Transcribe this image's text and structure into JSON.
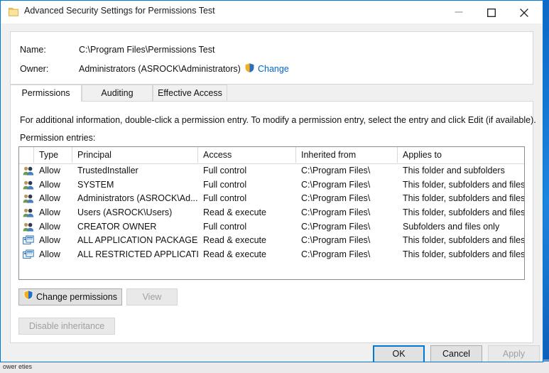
{
  "window": {
    "title": "Advanced Security Settings for Permissions Test",
    "icon": "folder-icon",
    "controls": {
      "minimize": "minimize-icon",
      "maximize": "maximize-icon",
      "close": "close-icon"
    }
  },
  "background_window": {
    "title": "ower eties"
  },
  "info": {
    "name_label": "Name:",
    "name_value": "C:\\Program Files\\Permissions Test",
    "owner_label": "Owner:",
    "owner_value": "Administrators (ASROCK\\Administrators)",
    "change_link": "Change",
    "change_icon": "uac-shield-icon"
  },
  "tabs": [
    {
      "label": "Permissions",
      "active": true
    },
    {
      "label": "Auditing",
      "active": false
    },
    {
      "label": "Effective Access",
      "active": false
    }
  ],
  "page": {
    "description": "For additional information, double-click a permission entry. To modify a permission entry, select the entry and click Edit (if available).",
    "entries_label": "Permission entries:"
  },
  "table": {
    "columns": [
      "",
      "Type",
      "Principal",
      "Access",
      "Inherited from",
      "Applies to"
    ],
    "rows": [
      {
        "icon": "users-group-icon",
        "type": "Allow",
        "principal": "TrustedInstaller",
        "access": "Full control",
        "inherited_from": "C:\\Program Files\\",
        "applies_to": "This folder and subfolders"
      },
      {
        "icon": "users-group-icon",
        "type": "Allow",
        "principal": "SYSTEM",
        "access": "Full control",
        "inherited_from": "C:\\Program Files\\",
        "applies_to": "This folder, subfolders and files"
      },
      {
        "icon": "users-group-icon",
        "type": "Allow",
        "principal": "Administrators (ASROCK\\Ad...",
        "access": "Full control",
        "inherited_from": "C:\\Program Files\\",
        "applies_to": "This folder, subfolders and files"
      },
      {
        "icon": "users-group-icon",
        "type": "Allow",
        "principal": "Users (ASROCK\\Users)",
        "access": "Read & execute",
        "inherited_from": "C:\\Program Files\\",
        "applies_to": "This folder, subfolders and files"
      },
      {
        "icon": "users-group-icon",
        "type": "Allow",
        "principal": "CREATOR OWNER",
        "access": "Full control",
        "inherited_from": "C:\\Program Files\\",
        "applies_to": "Subfolders and files only"
      },
      {
        "icon": "app-package-icon",
        "type": "Allow",
        "principal": "ALL APPLICATION PACKAGES",
        "access": "Read & execute",
        "inherited_from": "C:\\Program Files\\",
        "applies_to": "This folder, subfolders and files"
      },
      {
        "icon": "app-package-icon",
        "type": "Allow",
        "principal": "ALL RESTRICTED APPLICATIO...",
        "access": "Read & execute",
        "inherited_from": "C:\\Program Files\\",
        "applies_to": "This folder, subfolders and files"
      }
    ]
  },
  "actions": {
    "change_permissions": "Change permissions",
    "change_permissions_icon": "uac-shield-icon",
    "view": "View",
    "disable_inheritance": "Disable inheritance"
  },
  "footer": {
    "ok": "OK",
    "cancel": "Cancel",
    "apply": "Apply"
  },
  "colors": {
    "accent": "#0078d7",
    "link": "#0066cc",
    "disabled_text": "#a0a0a0",
    "folder": "#f7d57a",
    "shield_blue": "#2a6ec4",
    "shield_gold": "#f2b01e"
  }
}
